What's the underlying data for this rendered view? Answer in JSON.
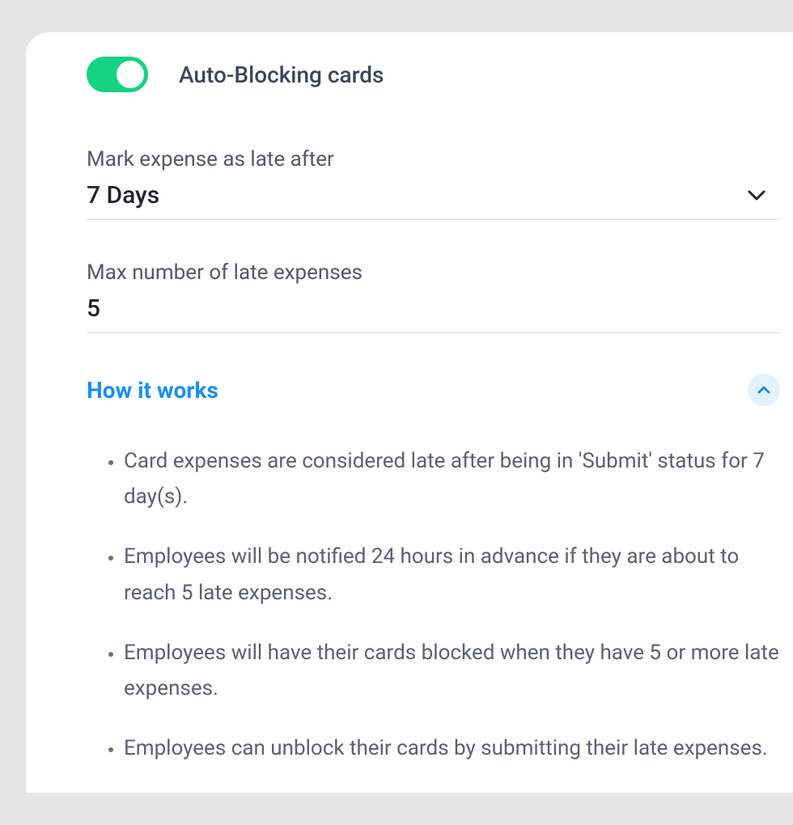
{
  "toggle": {
    "label": "Auto-Blocking cards",
    "enabled": true
  },
  "fields": {
    "late_after": {
      "label": "Mark expense as late after",
      "value": "7 Days"
    },
    "max_late": {
      "label": "Max number of late expenses",
      "value": "5"
    }
  },
  "how_it_works": {
    "title": "How it works",
    "expanded": true,
    "items": [
      "Card expenses are considered late after being in 'Submit' status for 7 day(s).",
      "Employees will be notified 24 hours in advance if they are about to reach 5 late expenses.",
      "Employees will have their cards blocked when they have 5 or more late expenses.",
      "Employees can unblock their cards by submitting their late expenses."
    ]
  }
}
